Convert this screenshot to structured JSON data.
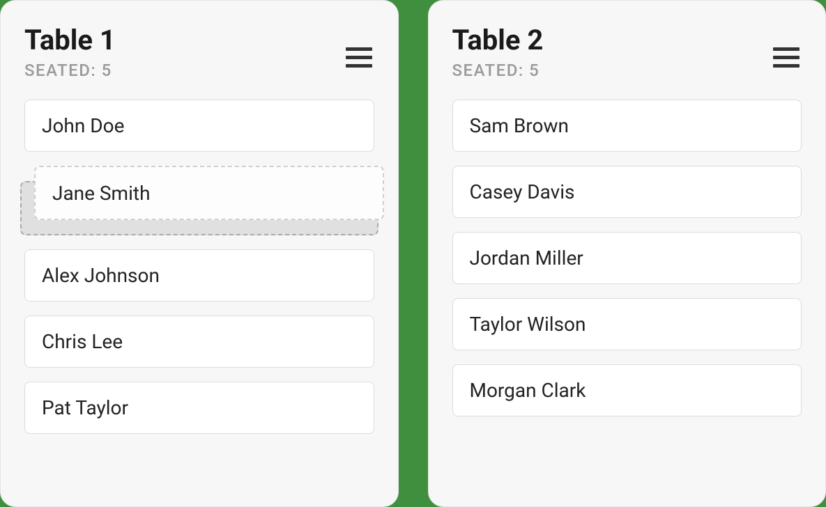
{
  "tables": [
    {
      "title": "Table 1",
      "seated_label": "SEATED: 5",
      "guests": [
        "John Doe",
        "Jane Smith",
        "Alex Johnson",
        "Chris Lee",
        "Pat Taylor"
      ],
      "dragging_index": 1
    },
    {
      "title": "Table 2",
      "seated_label": "SEATED: 5",
      "guests": [
        "Sam Brown",
        "Casey Davis",
        "Jordan Miller",
        "Taylor Wilson",
        "Morgan Clark"
      ]
    }
  ]
}
